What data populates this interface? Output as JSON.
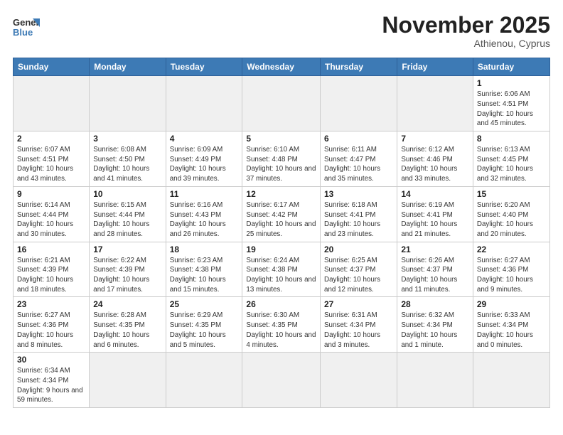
{
  "header": {
    "logo_general": "General",
    "logo_blue": "Blue",
    "month_title": "November 2025",
    "location": "Athienou, Cyprus"
  },
  "weekdays": [
    "Sunday",
    "Monday",
    "Tuesday",
    "Wednesday",
    "Thursday",
    "Friday",
    "Saturday"
  ],
  "weeks": [
    [
      {
        "day": null,
        "info": null
      },
      {
        "day": null,
        "info": null
      },
      {
        "day": null,
        "info": null
      },
      {
        "day": null,
        "info": null
      },
      {
        "day": null,
        "info": null
      },
      {
        "day": null,
        "info": null
      },
      {
        "day": "1",
        "info": "Sunrise: 6:06 AM\nSunset: 4:51 PM\nDaylight: 10 hours and 45 minutes."
      }
    ],
    [
      {
        "day": "2",
        "info": "Sunrise: 6:07 AM\nSunset: 4:51 PM\nDaylight: 10 hours and 43 minutes."
      },
      {
        "day": "3",
        "info": "Sunrise: 6:08 AM\nSunset: 4:50 PM\nDaylight: 10 hours and 41 minutes."
      },
      {
        "day": "4",
        "info": "Sunrise: 6:09 AM\nSunset: 4:49 PM\nDaylight: 10 hours and 39 minutes."
      },
      {
        "day": "5",
        "info": "Sunrise: 6:10 AM\nSunset: 4:48 PM\nDaylight: 10 hours and 37 minutes."
      },
      {
        "day": "6",
        "info": "Sunrise: 6:11 AM\nSunset: 4:47 PM\nDaylight: 10 hours and 35 minutes."
      },
      {
        "day": "7",
        "info": "Sunrise: 6:12 AM\nSunset: 4:46 PM\nDaylight: 10 hours and 33 minutes."
      },
      {
        "day": "8",
        "info": "Sunrise: 6:13 AM\nSunset: 4:45 PM\nDaylight: 10 hours and 32 minutes."
      }
    ],
    [
      {
        "day": "9",
        "info": "Sunrise: 6:14 AM\nSunset: 4:44 PM\nDaylight: 10 hours and 30 minutes."
      },
      {
        "day": "10",
        "info": "Sunrise: 6:15 AM\nSunset: 4:44 PM\nDaylight: 10 hours and 28 minutes."
      },
      {
        "day": "11",
        "info": "Sunrise: 6:16 AM\nSunset: 4:43 PM\nDaylight: 10 hours and 26 minutes."
      },
      {
        "day": "12",
        "info": "Sunrise: 6:17 AM\nSunset: 4:42 PM\nDaylight: 10 hours and 25 minutes."
      },
      {
        "day": "13",
        "info": "Sunrise: 6:18 AM\nSunset: 4:41 PM\nDaylight: 10 hours and 23 minutes."
      },
      {
        "day": "14",
        "info": "Sunrise: 6:19 AM\nSunset: 4:41 PM\nDaylight: 10 hours and 21 minutes."
      },
      {
        "day": "15",
        "info": "Sunrise: 6:20 AM\nSunset: 4:40 PM\nDaylight: 10 hours and 20 minutes."
      }
    ],
    [
      {
        "day": "16",
        "info": "Sunrise: 6:21 AM\nSunset: 4:39 PM\nDaylight: 10 hours and 18 minutes."
      },
      {
        "day": "17",
        "info": "Sunrise: 6:22 AM\nSunset: 4:39 PM\nDaylight: 10 hours and 17 minutes."
      },
      {
        "day": "18",
        "info": "Sunrise: 6:23 AM\nSunset: 4:38 PM\nDaylight: 10 hours and 15 minutes."
      },
      {
        "day": "19",
        "info": "Sunrise: 6:24 AM\nSunset: 4:38 PM\nDaylight: 10 hours and 13 minutes."
      },
      {
        "day": "20",
        "info": "Sunrise: 6:25 AM\nSunset: 4:37 PM\nDaylight: 10 hours and 12 minutes."
      },
      {
        "day": "21",
        "info": "Sunrise: 6:26 AM\nSunset: 4:37 PM\nDaylight: 10 hours and 11 minutes."
      },
      {
        "day": "22",
        "info": "Sunrise: 6:27 AM\nSunset: 4:36 PM\nDaylight: 10 hours and 9 minutes."
      }
    ],
    [
      {
        "day": "23",
        "info": "Sunrise: 6:27 AM\nSunset: 4:36 PM\nDaylight: 10 hours and 8 minutes."
      },
      {
        "day": "24",
        "info": "Sunrise: 6:28 AM\nSunset: 4:35 PM\nDaylight: 10 hours and 6 minutes."
      },
      {
        "day": "25",
        "info": "Sunrise: 6:29 AM\nSunset: 4:35 PM\nDaylight: 10 hours and 5 minutes."
      },
      {
        "day": "26",
        "info": "Sunrise: 6:30 AM\nSunset: 4:35 PM\nDaylight: 10 hours and 4 minutes."
      },
      {
        "day": "27",
        "info": "Sunrise: 6:31 AM\nSunset: 4:34 PM\nDaylight: 10 hours and 3 minutes."
      },
      {
        "day": "28",
        "info": "Sunrise: 6:32 AM\nSunset: 4:34 PM\nDaylight: 10 hours and 1 minute."
      },
      {
        "day": "29",
        "info": "Sunrise: 6:33 AM\nSunset: 4:34 PM\nDaylight: 10 hours and 0 minutes."
      }
    ],
    [
      {
        "day": "30",
        "info": "Sunrise: 6:34 AM\nSunset: 4:34 PM\nDaylight: 9 hours and 59 minutes."
      },
      {
        "day": null,
        "info": null
      },
      {
        "day": null,
        "info": null
      },
      {
        "day": null,
        "info": null
      },
      {
        "day": null,
        "info": null
      },
      {
        "day": null,
        "info": null
      },
      {
        "day": null,
        "info": null
      }
    ]
  ]
}
